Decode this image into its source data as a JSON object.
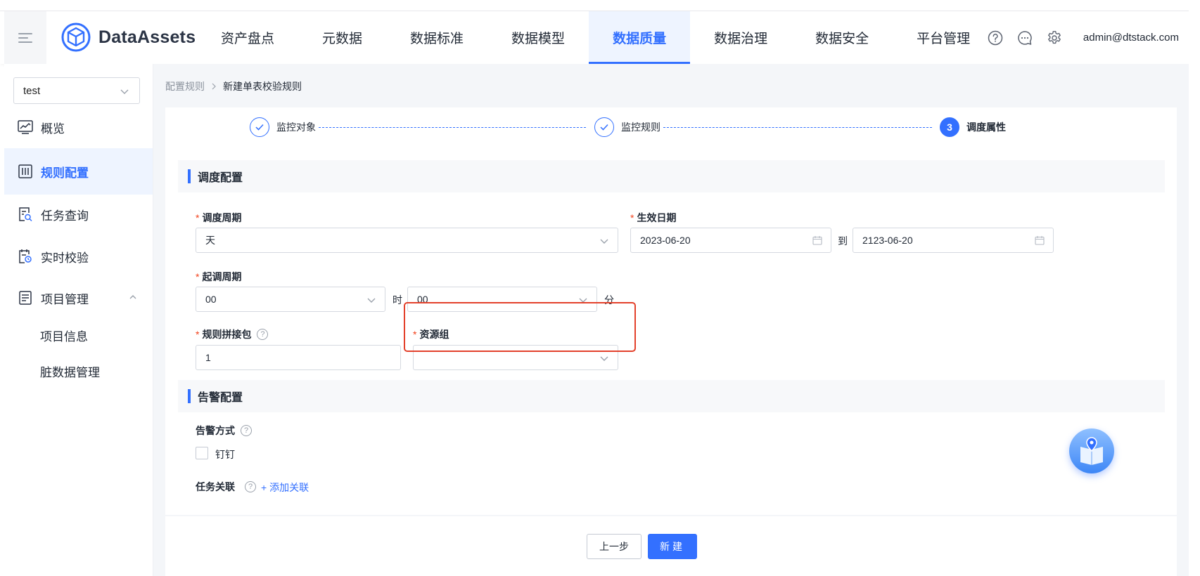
{
  "header": {
    "brand": "DataAssets",
    "nav": [
      "资产盘点",
      "元数据",
      "数据标准",
      "数据模型",
      "数据质量",
      "数据治理",
      "数据安全",
      "平台管理"
    ],
    "active_nav": "数据质量",
    "user": "admin@dtstack.com",
    "accent": "#3370ff"
  },
  "sidebar": {
    "project": "test",
    "items": [
      {
        "label": "概览",
        "icon": "overview-icon"
      },
      {
        "label": "规则配置",
        "icon": "rule-config-icon"
      },
      {
        "label": "任务查询",
        "icon": "task-query-icon"
      },
      {
        "label": "实时校验",
        "icon": "realtime-check-icon"
      },
      {
        "label": "项目管理",
        "icon": "project-manage-icon"
      }
    ],
    "sub_items": [
      "项目信息",
      "脏数据管理"
    ]
  },
  "breadcrumb": {
    "parent": "配置规则",
    "current": "新建单表校验规则"
  },
  "steps": [
    {
      "label": "监控对象",
      "status": "done"
    },
    {
      "label": "监控规则",
      "status": "done"
    },
    {
      "label": "调度属性",
      "status": "active",
      "number": "3"
    }
  ],
  "schedule": {
    "title": "调度配置",
    "cycle_label": "调度周期",
    "cycle_value": "天",
    "effective_label": "生效日期",
    "date_start": "2023-06-20",
    "date_to": "到",
    "date_end": "2123-06-20",
    "start_label": "起调周期",
    "hour_value": "00",
    "hour_unit": "时",
    "minute_value": "00",
    "minute_unit": "分",
    "package_label": "规则拼接包",
    "package_value": "1",
    "resource_label": "资源组",
    "resource_value": ""
  },
  "alert": {
    "title": "告警配置",
    "method_label": "告警方式",
    "dingtalk": "钉钉",
    "task_link_label": "任务关联",
    "add_link": "+ 添加关联"
  },
  "footer": {
    "prev": "上一步",
    "create": "新建"
  },
  "colors": {
    "highlight": "#e3412b",
    "required": "#f2411b"
  }
}
